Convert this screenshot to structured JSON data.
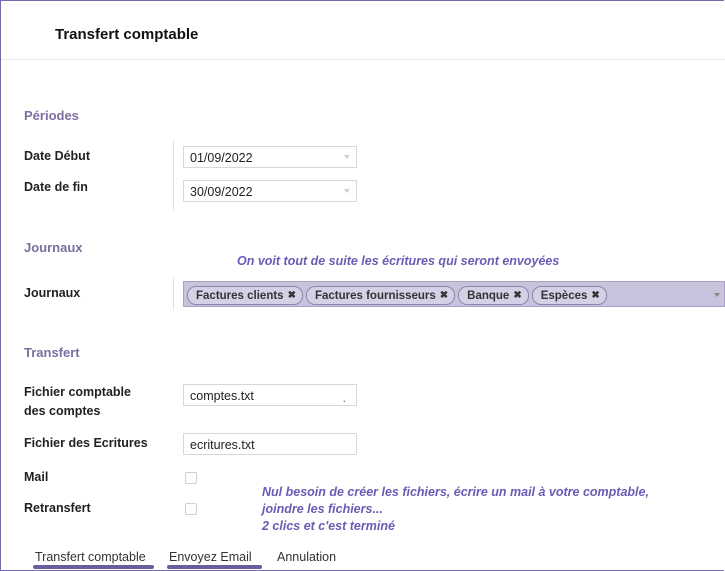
{
  "title": "Transfert comptable",
  "sections": {
    "periodes": "Périodes",
    "journaux": "Journaux",
    "transfert": "Transfert"
  },
  "fields": {
    "date_debut_label": "Date Début",
    "date_debut_value": "01/09/2022",
    "date_fin_label": "Date de fin",
    "date_fin_value": "30/09/2022",
    "journaux_label": "Journaux",
    "journaux_tags": [
      "Factures clients",
      "Factures fournisseurs",
      "Banque",
      "Espèces"
    ],
    "fichier_comptes_label_line1": "Fichier comptable",
    "fichier_comptes_label_line2": "des comptes",
    "fichier_comptes_value": "comptes.txt",
    "fichier_ecritures_label": "Fichier des Ecritures",
    "fichier_ecritures_value": "ecritures.txt",
    "mail_label": "Mail",
    "retransfert_label": "Retransfert"
  },
  "notes": {
    "note1": "On voit tout de suite les écritures qui seront envoyées",
    "note2_line1": "Nul besoin de créer les fichiers, écrire un mail à votre comptable,",
    "note2_line2": "joindre les fichiers...",
    "note2_line3": "2 clics et c'est terminé"
  },
  "buttons": {
    "transfert": "Transfert comptable",
    "email": "Envoyez Email",
    "annulation": "Annulation"
  },
  "colors": {
    "accent": "#6a5bb5",
    "section": "#7c6e9e",
    "tag_bg": "#c9c2dd"
  }
}
